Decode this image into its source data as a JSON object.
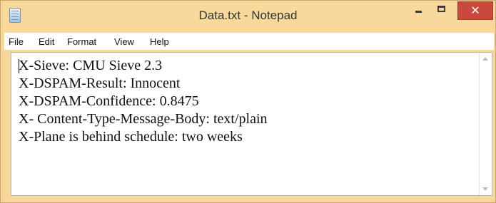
{
  "window": {
    "title": "Data.txt - Notepad",
    "close_symbol": "✕",
    "icons": [
      "notepad-app-icon",
      "minimize-icon",
      "maximize-icon",
      "close-icon"
    ],
    "colors": {
      "frame": "#f7d79a",
      "close_button": "#c94a3c"
    }
  },
  "menu": {
    "items": [
      {
        "label": "File"
      },
      {
        "label": "Edit"
      },
      {
        "label": "Format"
      },
      {
        "label": "View"
      },
      {
        "label": "Help"
      }
    ]
  },
  "document": {
    "lines": [
      "X-Sieve: CMU Sieve 2.3",
      "X-DSPAM-Result: Innocent",
      "X-DSPAM-Confidence: 0.8475",
      "X- Content-Type-Message-Body: text/plain",
      "X-Plane is behind schedule: two weeks"
    ]
  }
}
